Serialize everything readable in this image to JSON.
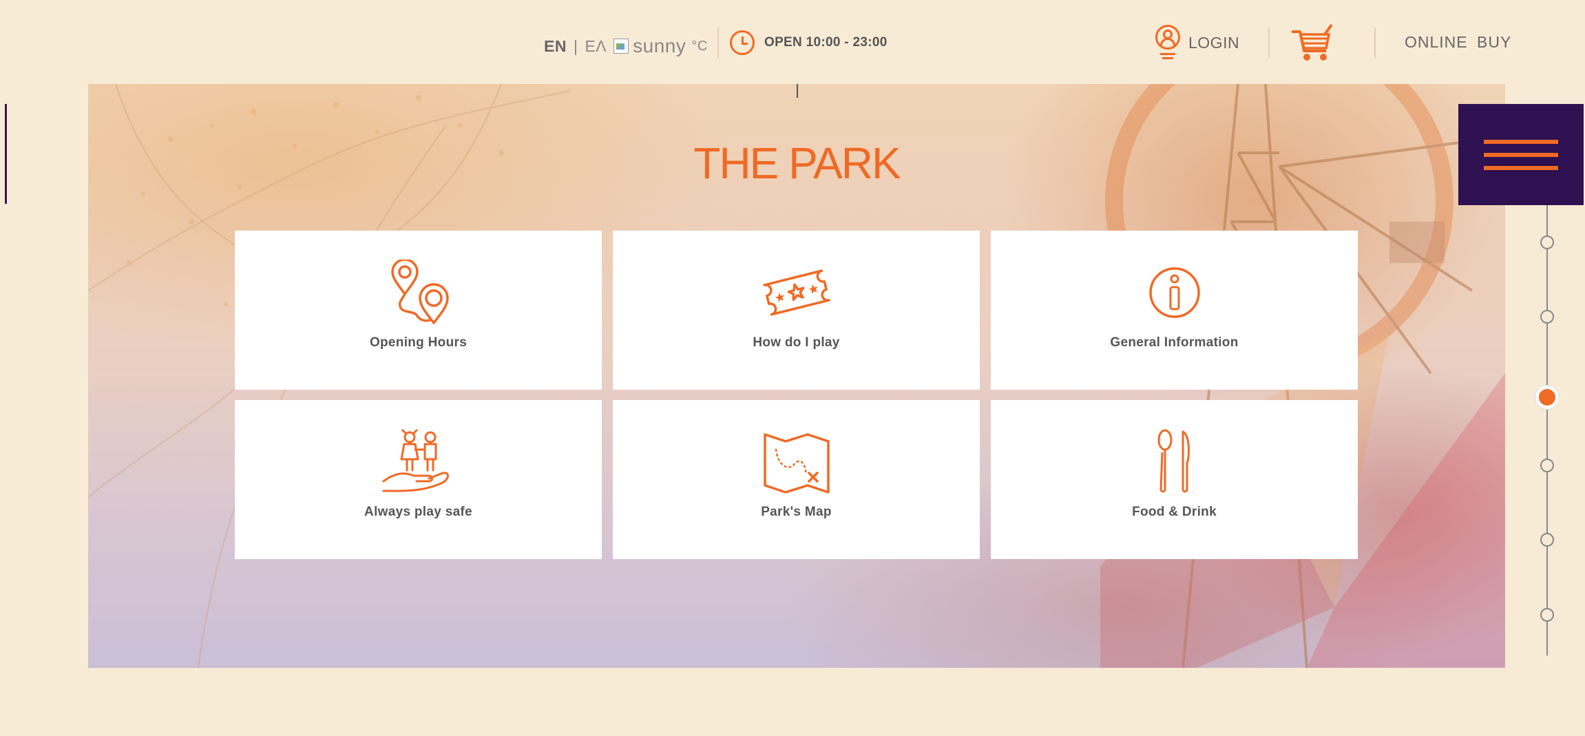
{
  "header": {
    "lang_en": "EN",
    "lang_sep": "|",
    "lang_el": "ΕΛ",
    "weather_condition": "sunny",
    "weather_unit": "°C",
    "hours": "OPEN 10:00 - 23:00",
    "login": "LOGIN",
    "online_buy": "ONLINE BUY"
  },
  "main": {
    "title": "THE PARK",
    "cards": [
      {
        "label": "Opening Hours",
        "icon": "map-pins-icon"
      },
      {
        "label": "How do I play",
        "icon": "ticket-stars-icon"
      },
      {
        "label": "General Information",
        "icon": "info-icon"
      },
      {
        "label": "Always play safe",
        "icon": "kids-hand-icon"
      },
      {
        "label": "Park's Map",
        "icon": "treasure-map-icon"
      },
      {
        "label": "Food & Drink",
        "icon": "spoon-knife-icon"
      }
    ]
  },
  "nav": {
    "section_count": 6,
    "active_index": 2
  },
  "colors": {
    "accent": "#ef6a25",
    "menu_bg": "#2e1150",
    "page_bg": "#f8ebd6"
  }
}
